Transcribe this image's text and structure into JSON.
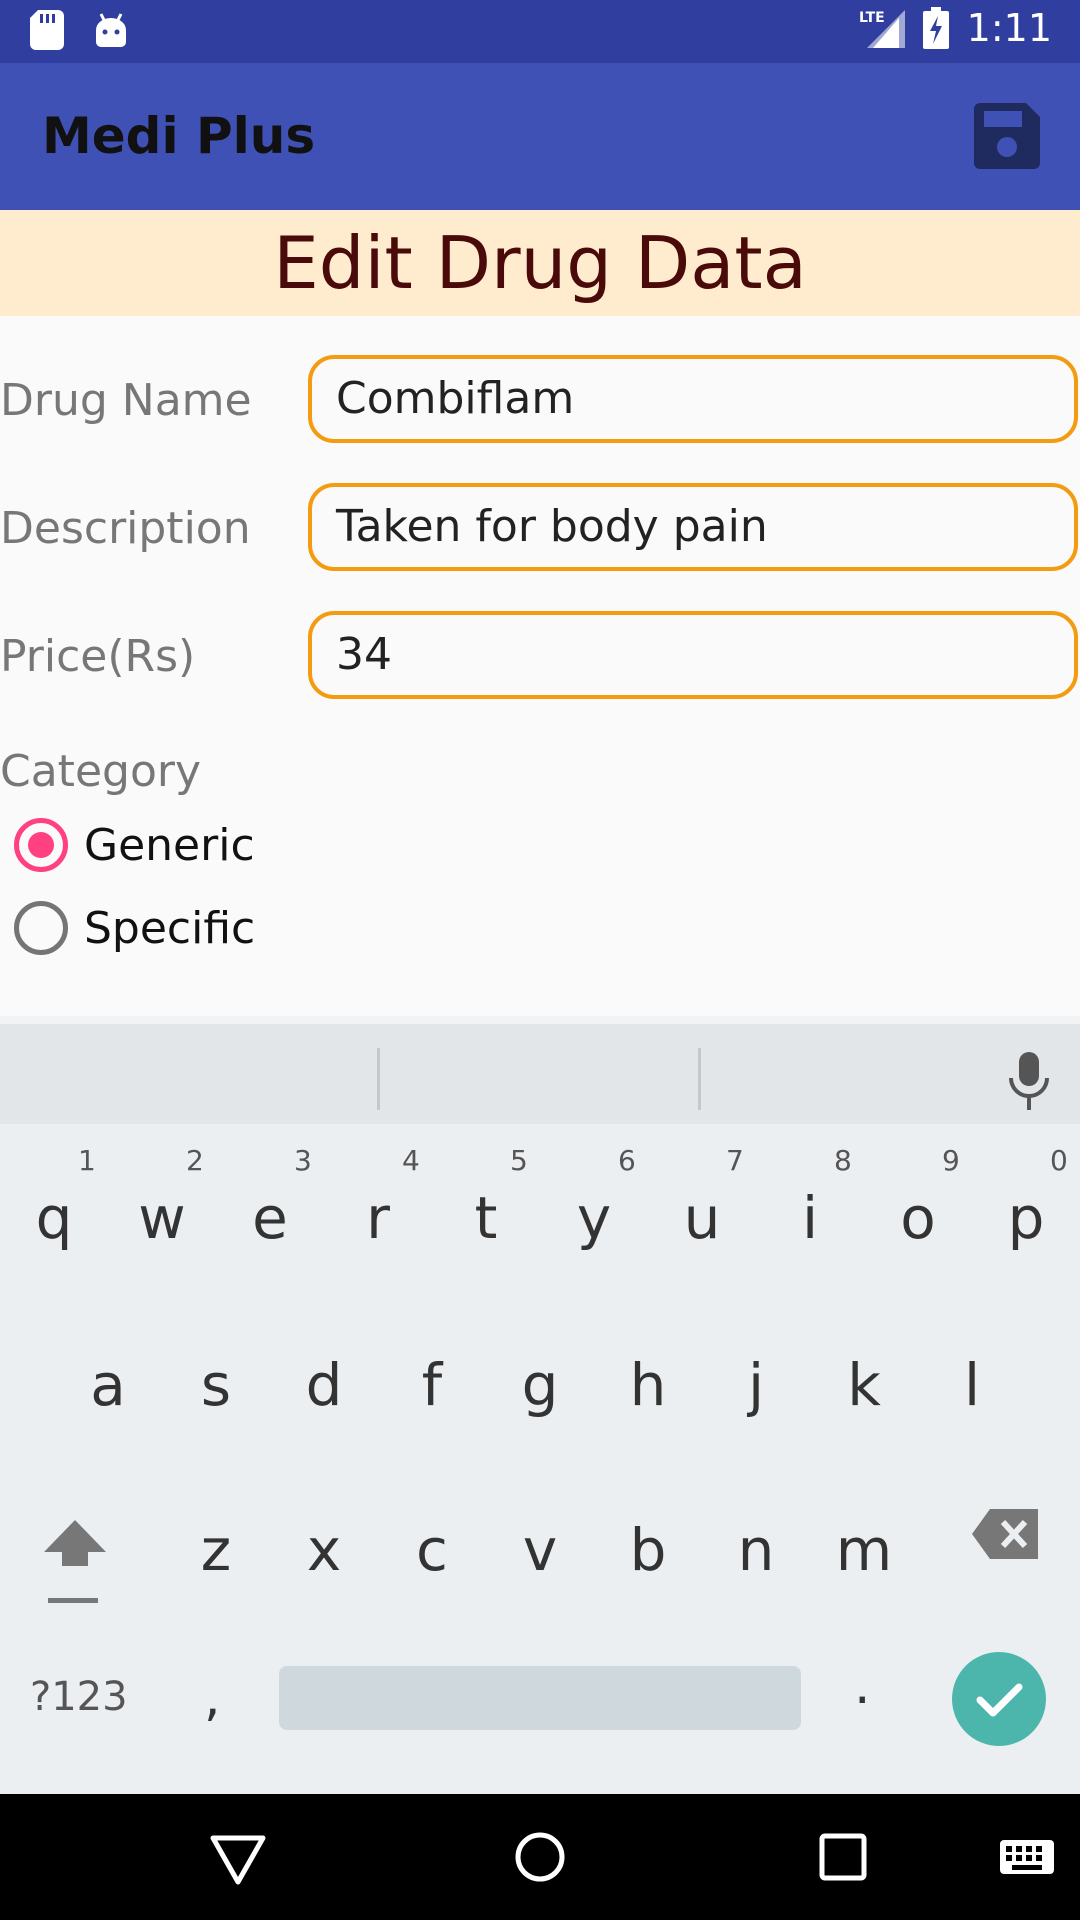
{
  "status_bar": {
    "network": "LTE",
    "time": "1:11"
  },
  "app_bar": {
    "title": "Medi Plus",
    "save_icon": "save-icon"
  },
  "banner": {
    "title": "Edit Drug Data"
  },
  "form": {
    "drug_name_label": "Drug Name",
    "drug_name_value": "Combiflam",
    "description_label": "Description",
    "description_value": "Taken for body pain",
    "price_label": "Price(Rs)",
    "price_value": "34",
    "category_label": "Category",
    "options": [
      {
        "label": "Generic",
        "checked": true
      },
      {
        "label": "Specific",
        "checked": false
      }
    ]
  },
  "keyboard": {
    "row1": [
      "q",
      "w",
      "e",
      "r",
      "t",
      "y",
      "u",
      "i",
      "o",
      "p"
    ],
    "row1_hints": [
      "1",
      "2",
      "3",
      "4",
      "5",
      "6",
      "7",
      "8",
      "9",
      "0"
    ],
    "row2": [
      "a",
      "s",
      "d",
      "f",
      "g",
      "h",
      "j",
      "k",
      "l"
    ],
    "row3": [
      "z",
      "x",
      "c",
      "v",
      "b",
      "n",
      "m"
    ],
    "symbols_label": "?123",
    "comma": ",",
    "period": "."
  },
  "colors": {
    "status_bar": "#303f9f",
    "app_bar": "#3f51b5",
    "banner": "#ffebcd",
    "input_border": "#f39c12",
    "radio_accent": "#ff4081",
    "done_button": "#4db6ac"
  }
}
